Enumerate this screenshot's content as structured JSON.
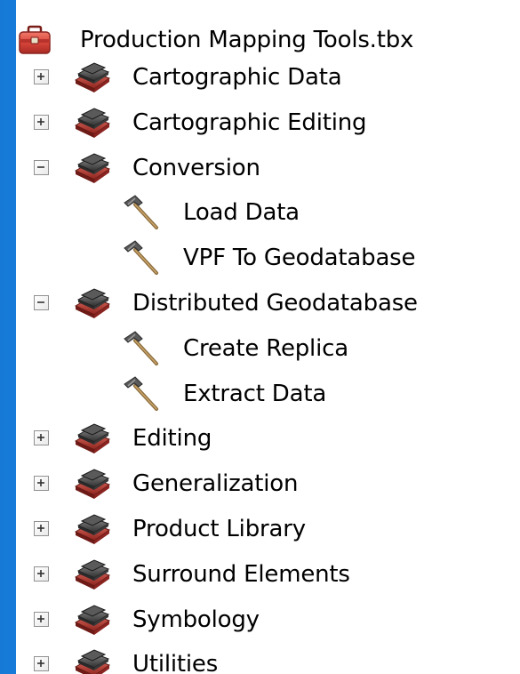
{
  "tree": {
    "root": {
      "label": "Production Mapping Tools.tbx",
      "icon": "toolbox-icon"
    },
    "items": [
      {
        "label": "Cartographic Data",
        "level": 1,
        "state": "collapsed",
        "icon": "toolset-icon"
      },
      {
        "label": "Cartographic Editing",
        "level": 1,
        "state": "collapsed",
        "icon": "toolset-icon"
      },
      {
        "label": "Conversion",
        "level": 1,
        "state": "expanded",
        "icon": "toolset-icon"
      },
      {
        "label": "Load Data",
        "level": 2,
        "state": "leaf",
        "icon": "tool-hammer-icon"
      },
      {
        "label": "VPF To Geodatabase",
        "level": 2,
        "state": "leaf",
        "icon": "tool-hammer-icon"
      },
      {
        "label": "Distributed Geodatabase",
        "level": 1,
        "state": "expanded",
        "icon": "toolset-icon"
      },
      {
        "label": "Create Replica",
        "level": 2,
        "state": "leaf",
        "icon": "tool-hammer-icon"
      },
      {
        "label": "Extract Data",
        "level": 2,
        "state": "leaf",
        "icon": "tool-hammer-icon"
      },
      {
        "label": "Editing",
        "level": 1,
        "state": "collapsed",
        "icon": "toolset-icon"
      },
      {
        "label": "Generalization",
        "level": 1,
        "state": "collapsed",
        "icon": "toolset-icon"
      },
      {
        "label": "Product Library",
        "level": 1,
        "state": "collapsed",
        "icon": "toolset-icon"
      },
      {
        "label": "Surround Elements",
        "level": 1,
        "state": "collapsed",
        "icon": "toolset-icon"
      },
      {
        "label": "Symbology",
        "level": 1,
        "state": "collapsed",
        "icon": "toolset-icon"
      },
      {
        "label": "Utilities",
        "level": 1,
        "state": "collapsed",
        "icon": "toolset-icon"
      }
    ]
  },
  "colors": {
    "background_blue": "#1e90ff",
    "panel": "#ffffff",
    "text": "#000000",
    "toolbox_red": "#c8322a",
    "toolset_dark": "#3a3a3a"
  }
}
